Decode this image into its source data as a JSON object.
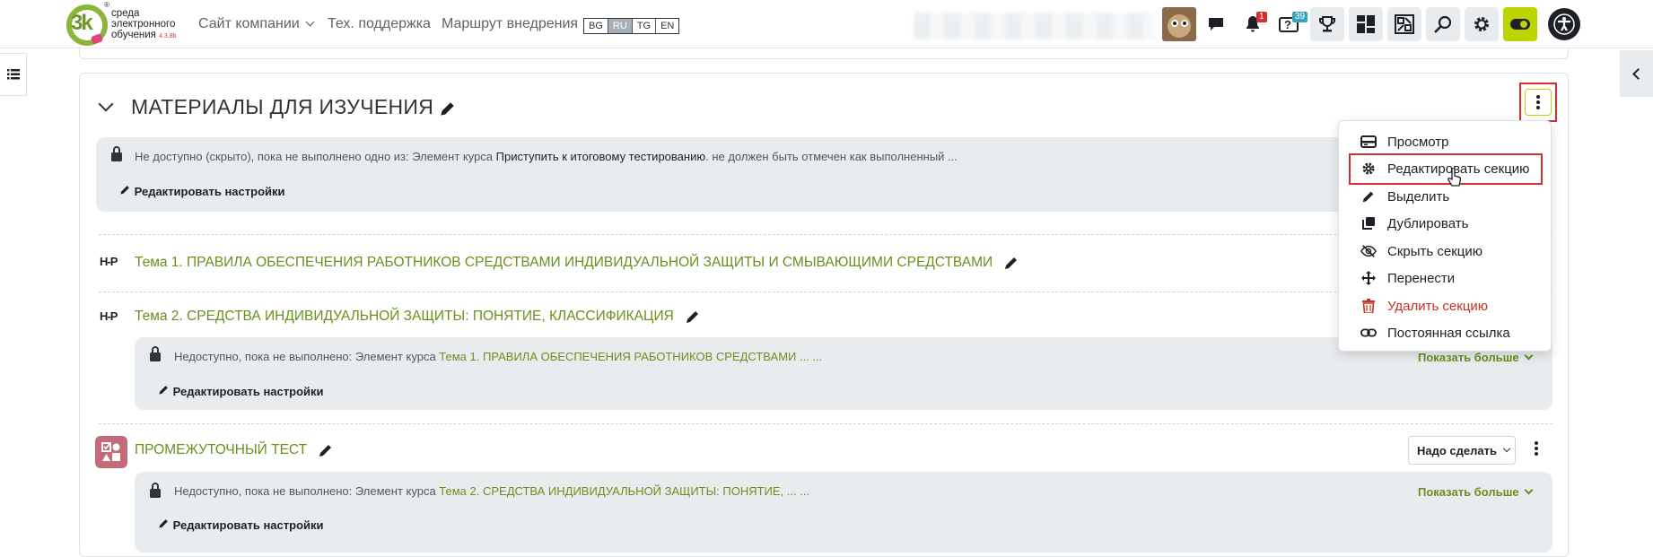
{
  "header": {
    "logo_lines": [
      "среда",
      "электронного",
      "обучения"
    ],
    "logo_version": "4.3.8b",
    "logo_mark": "3k",
    "nav_links": [
      "Сайт компании",
      "Тех. поддержка",
      "Маршрут внедрения"
    ],
    "languages": [
      "BG",
      "RU",
      "TG",
      "EN"
    ],
    "active_language": "RU",
    "notifications_count": "1",
    "questions_count": "39",
    "icons": [
      "messages-icon",
      "bell-icon",
      "help-icon",
      "trophy-icon",
      "dashboard-icon",
      "layout-icon",
      "search-icon",
      "gear-icon",
      "theme-toggle-icon",
      "accessibility-icon"
    ]
  },
  "section": {
    "title": "МАТЕРИАЛЫ ДЛЯ ИЗУЧЕНИЯ",
    "restriction": {
      "prefix": "Не доступно (скрыто), пока не выполнено одно из: Элемент курса ",
      "item": "Приступить к итоговому тестированию",
      "suffix": ". не должен быть отмечен как выполненный ...",
      "edit_label": "Редактировать настройки"
    }
  },
  "activities": [
    {
      "icon": "H-P",
      "name": "Тема 1. ПРАВИЛА ОБЕСПЕЧЕНИЯ РАБОТНИКОВ СРЕДСТВАМИ ИНДИВИДУАЛЬНОЙ ЗАЩИТЫ И СМЫВАЮЩИМИ СРЕДСТВАМИ"
    },
    {
      "icon": "H-P",
      "name": "Тема 2. СРЕДСТВА ИНДИВИДУАЛЬНОЙ ЗАЩИТЫ: ПОНЯТИЕ, КЛАССИФИКАЦИЯ",
      "restriction": {
        "prefix": "Недоступно, пока не выполнено: Элемент курса ",
        "item": "Тема 1. ПРАВИЛА ОБЕСПЕЧЕНИЯ РАБОТНИКОВ СРЕДСТВАМИ ... ...",
        "show_more": "Показать больше",
        "edit_label": "Редактировать настройки"
      }
    },
    {
      "icon": "quiz-icon",
      "name": "ПРОМЕЖУТОЧНЫЙ ТЕСТ",
      "todo_label": "Надо сделать",
      "restriction": {
        "prefix": "Недоступно, пока не выполнено: Элемент курса ",
        "item": "Тема 2. СРЕДСТВА ИНДИВИДУАЛЬНОЙ ЗАЩИТЫ: ПОНЯТИЕ, ... ...",
        "show_more": "Показать больше",
        "edit_label": "Редактировать настройки"
      }
    }
  ],
  "section_menu": {
    "items": [
      {
        "label": "Просмотр",
        "icon": "view-icon"
      },
      {
        "label": "Редактировать секцию",
        "icon": "gear-icon"
      },
      {
        "label": "Выделить",
        "icon": "pencil-icon"
      },
      {
        "label": "Дублировать",
        "icon": "duplicate-icon"
      },
      {
        "label": "Скрыть секцию",
        "icon": "eye-slash-icon"
      },
      {
        "label": "Перенести",
        "icon": "move-icon"
      },
      {
        "label": "Удалить секцию",
        "icon": "trash-icon"
      },
      {
        "label": "Постоянная ссылка",
        "icon": "link-icon"
      }
    ],
    "danger_color": "#ca3120"
  },
  "colors": {
    "accent_green": "#6a8f1d",
    "highlight_red": "#d32f2f",
    "toggle_lime": "#bcd400",
    "quiz_pink": "#c26b7a"
  }
}
